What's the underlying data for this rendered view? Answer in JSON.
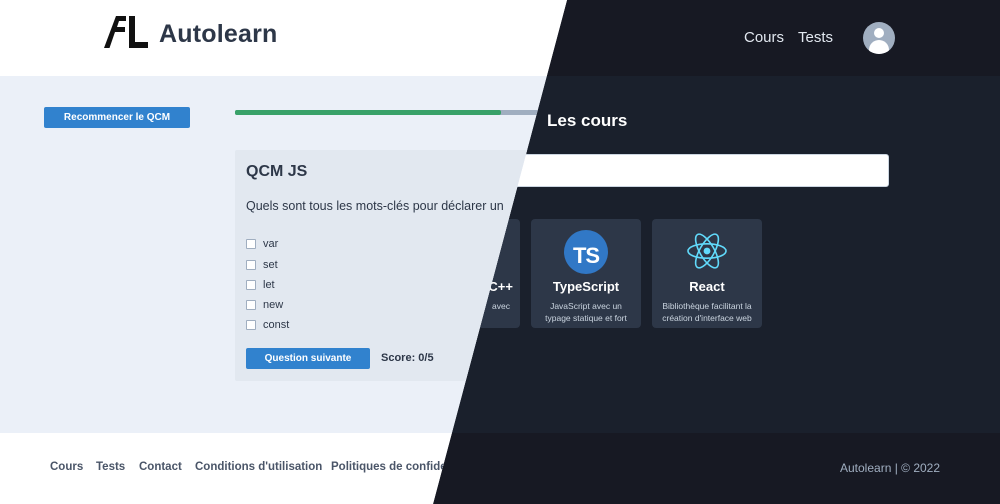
{
  "header": {
    "brand": "Autolearn",
    "nav": [
      "Cours",
      "Tests"
    ]
  },
  "courses_page": {
    "title": "Les cours",
    "cards": [
      {
        "title": "C++",
        "desc": "avec",
        "logo": "cpp-logo"
      },
      {
        "title": "TypeScript",
        "desc": "JavaScript avec un typage statique et fort",
        "logo": "typescript-logo"
      },
      {
        "title": "React",
        "desc": "Bibliothèque facilitant la création d'interface web",
        "logo": "react-logo"
      }
    ]
  },
  "qcm_page": {
    "restart_label": "Recommencer le QCM",
    "progress": 0.83,
    "title": "QCM JS",
    "question": "Quels sont tous les mots-clés pour déclarer un",
    "options": [
      "var",
      "set",
      "let",
      "new",
      "const"
    ],
    "next_label": "Question suivante",
    "score": "Score: 0/5"
  },
  "footer": {
    "links": [
      "Cours",
      "Tests",
      "Contact",
      "Conditions d'utilisation",
      "Politiques de confidentialité"
    ],
    "copyright": "Autolearn | © 2022"
  },
  "colors": {
    "accent": "#3182ce",
    "progress": "#38a169",
    "dark_bg": "#1a202c",
    "light_bg": "#ebf0f8"
  }
}
